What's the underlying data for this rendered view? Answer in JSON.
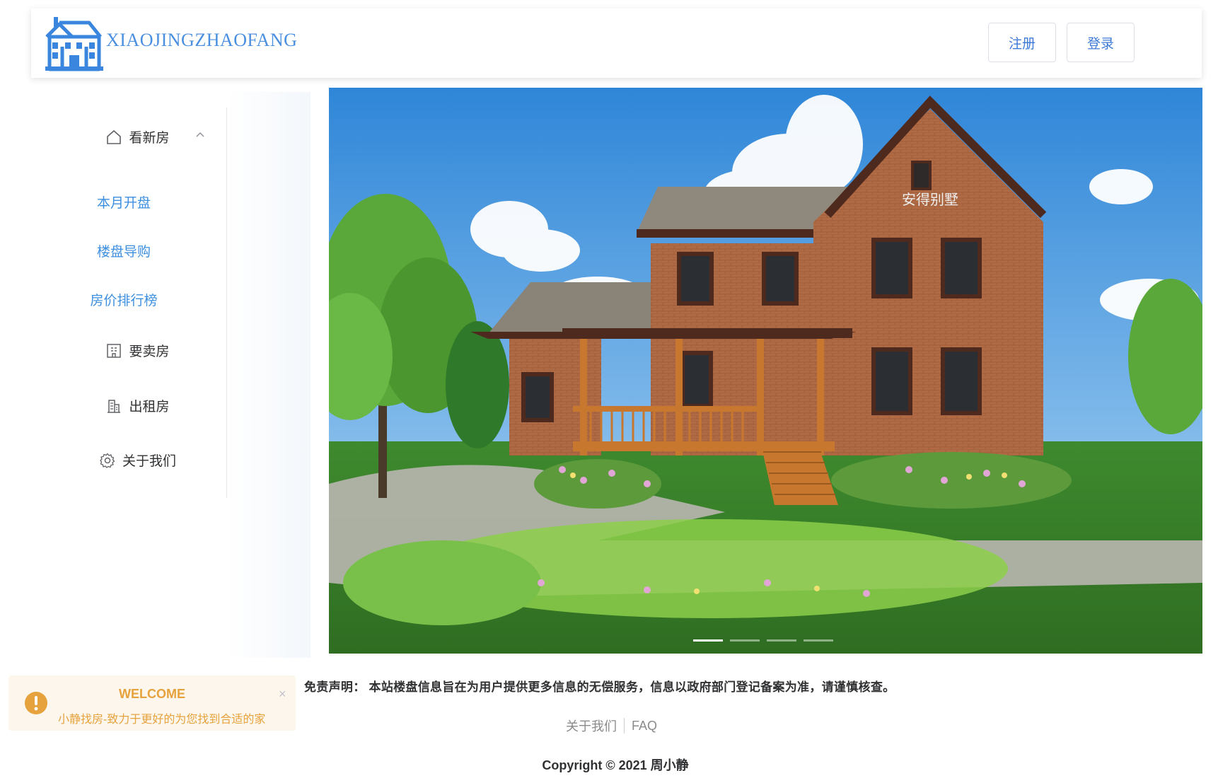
{
  "header": {
    "brand": "XIAOJINGZHAOFANG",
    "register_label": "注册",
    "login_label": "登录"
  },
  "sidebar": {
    "items": [
      {
        "label": "看新房",
        "icon": "home-icon",
        "expanded": true
      },
      {
        "label": "本月开盘"
      },
      {
        "label": "楼盘导购"
      },
      {
        "label": "房价排行榜"
      },
      {
        "label": "要卖房",
        "icon": "building-icon"
      },
      {
        "label": "出租房",
        "icon": "office-icon"
      },
      {
        "label": "关于我们",
        "icon": "gear-icon"
      }
    ]
  },
  "carousel": {
    "house_sign": "安得别墅",
    "slide_count": 4,
    "active_index": 0
  },
  "notification": {
    "title": "WELCOME",
    "message": "小静找房-致力于更好的为您找到合适的家",
    "close": "×"
  },
  "disclaimer": "免责声明：  本站楼盘信息旨在为用户提供更多信息的无偿服务，信息以政府部门登记备案为准，请谨慎核查。",
  "footer": {
    "links": [
      "关于我们",
      "FAQ"
    ],
    "copyright": "Copyright © 2021 周小静"
  },
  "colors": {
    "accent": "#3d8fe0",
    "warning": "#e6a23c",
    "warning_bg": "#fdf6ec"
  }
}
